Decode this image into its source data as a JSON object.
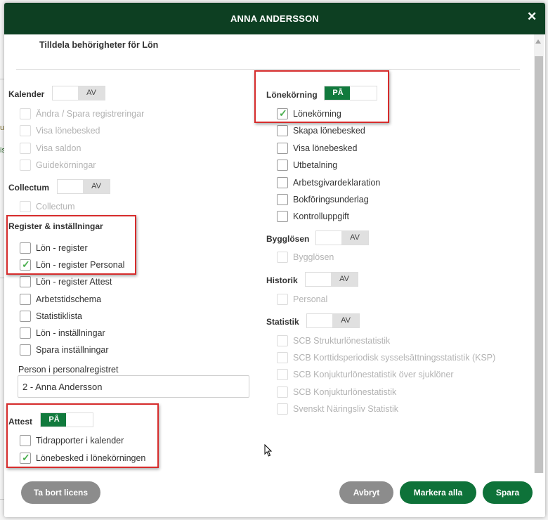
{
  "modal": {
    "title": "ANNA ANDERSSON",
    "subtitle": "Tilldela behörigheter för Lön",
    "close_icon": "close-icon"
  },
  "left": {
    "kalender": {
      "label": "Kalender",
      "toggle": "AV",
      "items": [
        {
          "label": "Ändra / Spara registreringar",
          "checked": false,
          "disabled": true
        },
        {
          "label": "Visa lönebesked",
          "checked": false,
          "disabled": true
        },
        {
          "label": "Visa saldon",
          "checked": false,
          "disabled": true
        },
        {
          "label": "Guidekörningar",
          "checked": false,
          "disabled": true
        }
      ]
    },
    "collectum": {
      "label": "Collectum",
      "toggle": "AV",
      "items": [
        {
          "label": "Collectum",
          "checked": false,
          "disabled": true
        }
      ]
    },
    "register": {
      "label": "Register & inställningar",
      "items": [
        {
          "label": "Lön - register",
          "checked": false,
          "disabled": false
        },
        {
          "label": "Lön - register Personal",
          "checked": true,
          "disabled": false
        },
        {
          "label": "Lön - register Attest",
          "checked": false,
          "disabled": false
        },
        {
          "label": "Arbetstidschema",
          "checked": false,
          "disabled": false
        },
        {
          "label": "Statistiklista",
          "checked": false,
          "disabled": false
        },
        {
          "label": "Lön - inställningar",
          "checked": false,
          "disabled": false
        },
        {
          "label": "Spara inställningar",
          "checked": false,
          "disabled": false
        }
      ],
      "person_label": "Person i personalregistret",
      "person_value": "2 - Anna Andersson"
    },
    "attest": {
      "label": "Attest",
      "toggle": "PÅ",
      "items": [
        {
          "label": "Tidrapporter i kalender",
          "checked": false,
          "disabled": false
        },
        {
          "label": "Lönebesked i lönekörningen",
          "checked": true,
          "disabled": false
        }
      ]
    }
  },
  "right": {
    "lonekorning": {
      "label": "Lönekörning",
      "toggle": "PÅ",
      "items": [
        {
          "label": "Lönekörning",
          "checked": true,
          "disabled": false
        },
        {
          "label": "Skapa lönebesked",
          "checked": false,
          "disabled": false
        },
        {
          "label": "Visa lönebesked",
          "checked": false,
          "disabled": false
        },
        {
          "label": "Utbetalning",
          "checked": false,
          "disabled": false
        },
        {
          "label": "Arbetsgivardeklaration",
          "checked": false,
          "disabled": false
        },
        {
          "label": "Bokföringsunderlag",
          "checked": false,
          "disabled": false
        },
        {
          "label": "Kontrolluppgift",
          "checked": false,
          "disabled": false
        }
      ]
    },
    "bygglosen": {
      "label": "Bygglösen",
      "toggle": "AV",
      "items": [
        {
          "label": "Bygglösen",
          "checked": false,
          "disabled": true
        }
      ]
    },
    "historik": {
      "label": "Historik",
      "toggle": "AV",
      "items": [
        {
          "label": "Personal",
          "checked": false,
          "disabled": true
        }
      ]
    },
    "statistik": {
      "label": "Statistik",
      "toggle": "AV",
      "items": [
        {
          "label": "SCB Strukturlönestatistik",
          "checked": false,
          "disabled": true
        },
        {
          "label": "SCB Korttidsperiodisk sysselsättningsstatistik (KSP)",
          "checked": false,
          "disabled": true
        },
        {
          "label": "SCB Konjukturlönestatistik över sjuklöner",
          "checked": false,
          "disabled": true
        },
        {
          "label": "SCB Konjukturlönestatistik",
          "checked": false,
          "disabled": true
        },
        {
          "label": "Svenskt Näringsliv Statistik",
          "checked": false,
          "disabled": true
        }
      ]
    }
  },
  "footer": {
    "remove_license": "Ta bort licens",
    "cancel": "Avbryt",
    "select_all": "Markera alla",
    "save": "Spara"
  },
  "background_fragments": [
    "u",
    "is"
  ],
  "colors": {
    "header": "#0d3f22",
    "accent": "#117a3d",
    "highlight": "#d62c2c",
    "check": "#4caf50"
  }
}
